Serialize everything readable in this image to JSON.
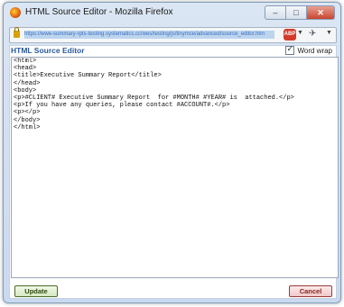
{
  "window": {
    "title": "HTML Source Editor - Mozilla Firefox",
    "buttons": {
      "minimize": "–",
      "maximize": "□",
      "close": "✕"
    }
  },
  "urlbar": {
    "url": "https://wwe-summary-rpts-testing.systematics.cc/wes/testing/js/tinymce/advanced/source_editor.htm"
  },
  "toolbar": {
    "abp_label": "ABP"
  },
  "editor": {
    "heading": "HTML Source Editor",
    "word_wrap_label": "Word wrap",
    "word_wrap_checked": true,
    "source": "<html>\n<head>\n<title>Executive Summary Report</title>\n</head>\n<body>\n<p>#CLIENT# Executive Summary Report  for #MONTH# #YEAR# is  attached.</p>\n<p>If you have any queries, please contact #ACCOUNT#.</p>\n<p></p>\n</body>\n</html>"
  },
  "actions": {
    "update_label": "Update",
    "cancel_label": "Cancel"
  }
}
